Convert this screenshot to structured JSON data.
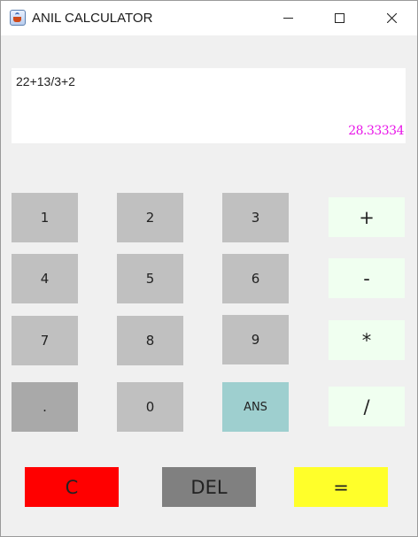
{
  "window": {
    "title": "ANIL CALCULATOR",
    "icon": "java-cup-icon"
  },
  "display": {
    "expression": "22+13/3+2",
    "result": "28.33334"
  },
  "keypad": {
    "digits": [
      "1",
      "2",
      "3",
      "4",
      "5",
      "6",
      "7",
      "8",
      "9",
      ".",
      "0",
      "ANS"
    ],
    "operators": [
      "+",
      "-",
      "*",
      "/"
    ]
  },
  "actions": {
    "clear": "C",
    "delete": "DEL",
    "equals": "="
  },
  "colors": {
    "digit_key": "#c0c0c0",
    "dot_key": "#a9a9a9",
    "ans_key": "#9ecfcf",
    "operator_key": "#f0fff0",
    "clear_key": "#ff0000",
    "delete_key": "#808080",
    "equals_key": "#ffff2a",
    "result_text": "#e815e8"
  }
}
